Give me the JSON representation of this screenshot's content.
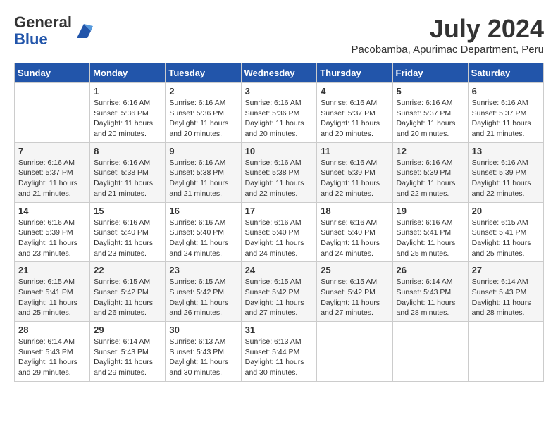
{
  "logo": {
    "general": "General",
    "blue": "Blue"
  },
  "title": "July 2024",
  "location": "Pacobamba, Apurimac Department, Peru",
  "weekdays": [
    "Sunday",
    "Monday",
    "Tuesday",
    "Wednesday",
    "Thursday",
    "Friday",
    "Saturday"
  ],
  "weeks": [
    [
      {
        "day": "",
        "info": ""
      },
      {
        "day": "1",
        "info": "Sunrise: 6:16 AM\nSunset: 5:36 PM\nDaylight: 11 hours\nand 20 minutes."
      },
      {
        "day": "2",
        "info": "Sunrise: 6:16 AM\nSunset: 5:36 PM\nDaylight: 11 hours\nand 20 minutes."
      },
      {
        "day": "3",
        "info": "Sunrise: 6:16 AM\nSunset: 5:36 PM\nDaylight: 11 hours\nand 20 minutes."
      },
      {
        "day": "4",
        "info": "Sunrise: 6:16 AM\nSunset: 5:37 PM\nDaylight: 11 hours\nand 20 minutes."
      },
      {
        "day": "5",
        "info": "Sunrise: 6:16 AM\nSunset: 5:37 PM\nDaylight: 11 hours\nand 20 minutes."
      },
      {
        "day": "6",
        "info": "Sunrise: 6:16 AM\nSunset: 5:37 PM\nDaylight: 11 hours\nand 21 minutes."
      }
    ],
    [
      {
        "day": "7",
        "info": "Sunrise: 6:16 AM\nSunset: 5:37 PM\nDaylight: 11 hours\nand 21 minutes."
      },
      {
        "day": "8",
        "info": "Sunrise: 6:16 AM\nSunset: 5:38 PM\nDaylight: 11 hours\nand 21 minutes."
      },
      {
        "day": "9",
        "info": "Sunrise: 6:16 AM\nSunset: 5:38 PM\nDaylight: 11 hours\nand 21 minutes."
      },
      {
        "day": "10",
        "info": "Sunrise: 6:16 AM\nSunset: 5:38 PM\nDaylight: 11 hours\nand 22 minutes."
      },
      {
        "day": "11",
        "info": "Sunrise: 6:16 AM\nSunset: 5:39 PM\nDaylight: 11 hours\nand 22 minutes."
      },
      {
        "day": "12",
        "info": "Sunrise: 6:16 AM\nSunset: 5:39 PM\nDaylight: 11 hours\nand 22 minutes."
      },
      {
        "day": "13",
        "info": "Sunrise: 6:16 AM\nSunset: 5:39 PM\nDaylight: 11 hours\nand 22 minutes."
      }
    ],
    [
      {
        "day": "14",
        "info": "Sunrise: 6:16 AM\nSunset: 5:39 PM\nDaylight: 11 hours\nand 23 minutes."
      },
      {
        "day": "15",
        "info": "Sunrise: 6:16 AM\nSunset: 5:40 PM\nDaylight: 11 hours\nand 23 minutes."
      },
      {
        "day": "16",
        "info": "Sunrise: 6:16 AM\nSunset: 5:40 PM\nDaylight: 11 hours\nand 24 minutes."
      },
      {
        "day": "17",
        "info": "Sunrise: 6:16 AM\nSunset: 5:40 PM\nDaylight: 11 hours\nand 24 minutes."
      },
      {
        "day": "18",
        "info": "Sunrise: 6:16 AM\nSunset: 5:40 PM\nDaylight: 11 hours\nand 24 minutes."
      },
      {
        "day": "19",
        "info": "Sunrise: 6:16 AM\nSunset: 5:41 PM\nDaylight: 11 hours\nand 25 minutes."
      },
      {
        "day": "20",
        "info": "Sunrise: 6:15 AM\nSunset: 5:41 PM\nDaylight: 11 hours\nand 25 minutes."
      }
    ],
    [
      {
        "day": "21",
        "info": "Sunrise: 6:15 AM\nSunset: 5:41 PM\nDaylight: 11 hours\nand 25 minutes."
      },
      {
        "day": "22",
        "info": "Sunrise: 6:15 AM\nSunset: 5:42 PM\nDaylight: 11 hours\nand 26 minutes."
      },
      {
        "day": "23",
        "info": "Sunrise: 6:15 AM\nSunset: 5:42 PM\nDaylight: 11 hours\nand 26 minutes."
      },
      {
        "day": "24",
        "info": "Sunrise: 6:15 AM\nSunset: 5:42 PM\nDaylight: 11 hours\nand 27 minutes."
      },
      {
        "day": "25",
        "info": "Sunrise: 6:15 AM\nSunset: 5:42 PM\nDaylight: 11 hours\nand 27 minutes."
      },
      {
        "day": "26",
        "info": "Sunrise: 6:14 AM\nSunset: 5:43 PM\nDaylight: 11 hours\nand 28 minutes."
      },
      {
        "day": "27",
        "info": "Sunrise: 6:14 AM\nSunset: 5:43 PM\nDaylight: 11 hours\nand 28 minutes."
      }
    ],
    [
      {
        "day": "28",
        "info": "Sunrise: 6:14 AM\nSunset: 5:43 PM\nDaylight: 11 hours\nand 29 minutes."
      },
      {
        "day": "29",
        "info": "Sunrise: 6:14 AM\nSunset: 5:43 PM\nDaylight: 11 hours\nand 29 minutes."
      },
      {
        "day": "30",
        "info": "Sunrise: 6:13 AM\nSunset: 5:43 PM\nDaylight: 11 hours\nand 30 minutes."
      },
      {
        "day": "31",
        "info": "Sunrise: 6:13 AM\nSunset: 5:44 PM\nDaylight: 11 hours\nand 30 minutes."
      },
      {
        "day": "",
        "info": ""
      },
      {
        "day": "",
        "info": ""
      },
      {
        "day": "",
        "info": ""
      }
    ]
  ]
}
